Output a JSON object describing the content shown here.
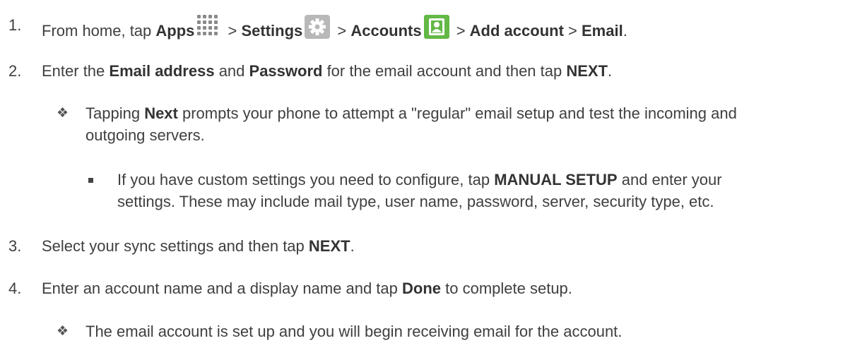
{
  "steps": [
    {
      "number": "1.",
      "parts": {
        "a": "From home, tap ",
        "apps": "Apps",
        "sep1": " > ",
        "settings": "Settings",
        "sep2": " > ",
        "accounts": "Accounts",
        "sep3": " > ",
        "add_account": "Add account",
        "sep4": " > ",
        "email": "Email",
        "end": "."
      },
      "icons": [
        "apps-grid-icon",
        "settings-gear-icon",
        "accounts-contact-icon"
      ]
    },
    {
      "number": "2.",
      "parts": {
        "a": "Enter the ",
        "b1": "Email address",
        "c": " and ",
        "b2": "Password",
        "d": " for the email account and then tap ",
        "b3": "NEXT",
        "end": "."
      }
    },
    {
      "number": "3.",
      "parts": {
        "a": "Select your sync settings and then tap ",
        "b1": "NEXT",
        "end": "."
      }
    },
    {
      "number": "4.",
      "parts": {
        "a": "Enter an account name and a display name and tap ",
        "b1": "Done",
        "end": " to complete setup."
      }
    }
  ],
  "notes": {
    "next_note": {
      "marker": "❖",
      "a": "Tapping ",
      "b1": "Next",
      "line1_rest": " prompts your phone to attempt a \"regular\" email setup and test the incoming and",
      "line2": "outgoing servers."
    },
    "manual_note": {
      "a": "If you have custom settings you need to configure, tap ",
      "b1": "MANUAL SETUP",
      "line1_rest": " and enter your",
      "line2": "settings. These may include mail type, user name, password, server, security type, etc."
    },
    "done_note": {
      "marker": "❖",
      "text": "The email account is set up and you will begin receiving email for the account."
    }
  },
  "colors": {
    "text": "#3f3f3f",
    "settings_icon": "#b8b8b8",
    "accounts_icon": "#63b846"
  }
}
